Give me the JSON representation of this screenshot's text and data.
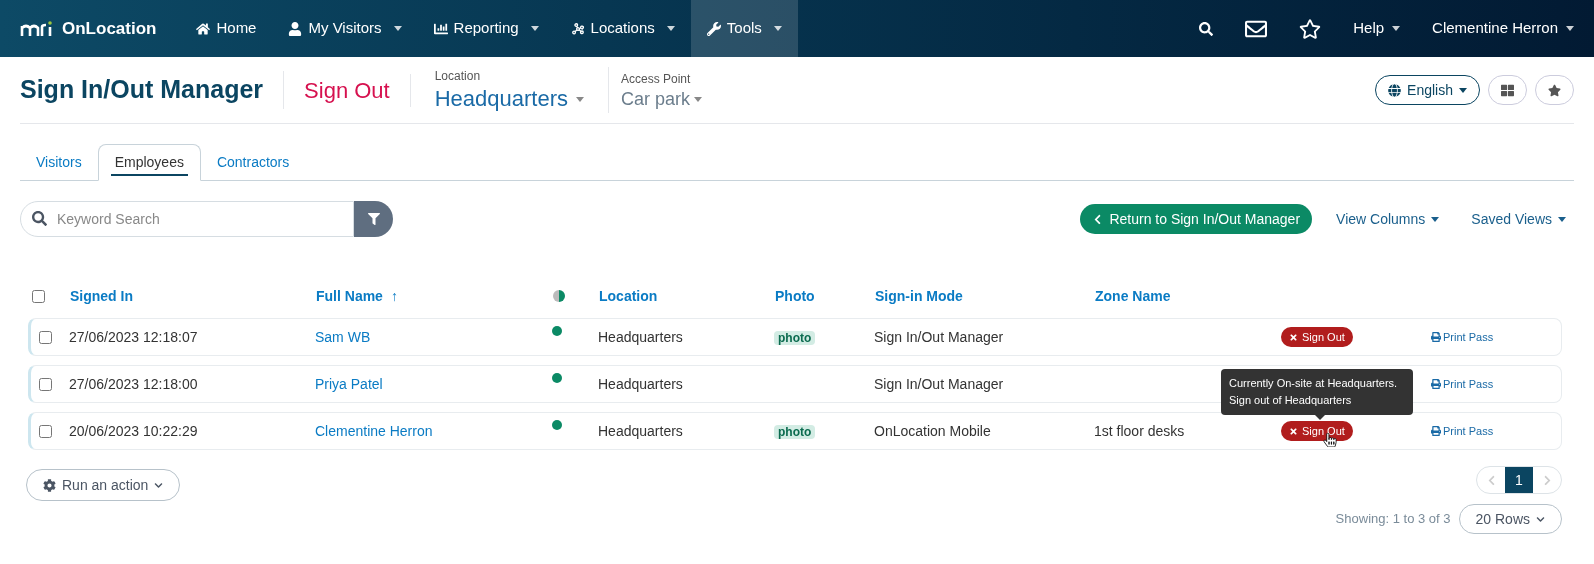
{
  "nav": {
    "brand": "OnLocation",
    "items": [
      {
        "label": "Home",
        "dropdown": false,
        "selected": false
      },
      {
        "label": "My Visitors",
        "dropdown": true,
        "selected": false
      },
      {
        "label": "Reporting",
        "dropdown": true,
        "selected": false
      },
      {
        "label": "Locations",
        "dropdown": true,
        "selected": false
      },
      {
        "label": "Tools",
        "dropdown": true,
        "selected": true
      }
    ],
    "help": "Help",
    "user": "Clementine Herron"
  },
  "header": {
    "title": "Sign In/Out Manager",
    "action": "Sign Out",
    "location_label": "Location",
    "location": "Headquarters",
    "access_label": "Access Point",
    "access": "Car park",
    "language": "English"
  },
  "tabs": [
    {
      "label": "Visitors",
      "selected": false
    },
    {
      "label": "Employees",
      "selected": true
    },
    {
      "label": "Contractors",
      "selected": false
    }
  ],
  "search": {
    "placeholder": "Keyword Search"
  },
  "toolbar": {
    "return": "Return to Sign In/Out Manager",
    "view_columns": "View Columns",
    "saved_views": "Saved Views"
  },
  "table": {
    "all_checked": false,
    "columns": [
      {
        "label": "Signed In",
        "kind": "text"
      },
      {
        "label": "Full Name",
        "kind": "text",
        "sort_indicator": "↑"
      },
      {
        "kind": "status-icon"
      },
      {
        "label": "Location",
        "kind": "text"
      },
      {
        "label": "Photo",
        "kind": "text"
      },
      {
        "label": "Sign-in Mode",
        "kind": "text"
      },
      {
        "label": "Zone Name",
        "kind": "text"
      }
    ],
    "rows": [
      {
        "checked": false,
        "signed_in": "27/06/2023 12:18:07",
        "name": "Sam WB",
        "on_site": true,
        "location": "Headquarters",
        "photo": "photo",
        "mode": "Sign In/Out Manager",
        "sign_out": "Sign Out",
        "print": "Print Pass"
      },
      {
        "checked": false,
        "signed_in": "27/06/2023 12:18:00",
        "name": "Priya Patel",
        "on_site": true,
        "location": "Headquarters",
        "mode": "Sign In/Out Manager",
        "print": "Print Pass"
      },
      {
        "checked": false,
        "signed_in": "20/06/2023 10:22:29",
        "name": "Clementine Herron",
        "on_site": true,
        "location": "Headquarters",
        "photo": "photo",
        "mode": "OnLocation Mobile",
        "zone": "1st floor desks",
        "sign_out": "Sign Out",
        "print": "Print Pass",
        "tooltip": [
          "Currently On-site at Headquarters.",
          "Sign out of Headquarters"
        ]
      }
    ]
  },
  "footer": {
    "action": "Run an action",
    "page": "1",
    "showing": "Showing: 1 to 3 of 3",
    "rows": "20 Rows"
  }
}
